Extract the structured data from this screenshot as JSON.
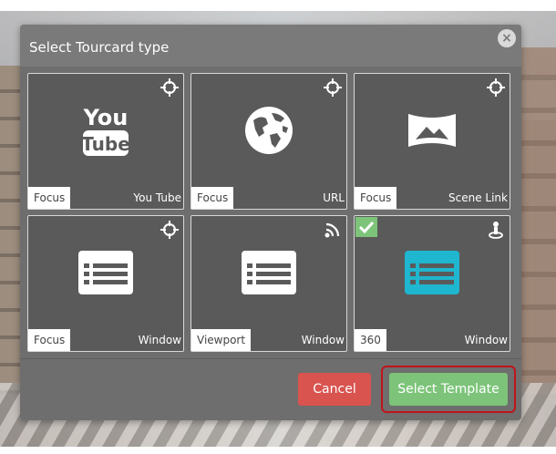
{
  "modal": {
    "title": "Select Tourcard type",
    "close_label": "×"
  },
  "cards": [
    {
      "tag": "Focus",
      "type": "You Tube",
      "icon": "youtube-icon",
      "corner_icon": "crosshair-icon",
      "checked": false
    },
    {
      "tag": "Focus",
      "type": "URL",
      "icon": "globe-icon",
      "corner_icon": "crosshair-icon",
      "checked": false
    },
    {
      "tag": "Focus",
      "type": "Scene Link",
      "icon": "panorama-icon",
      "corner_icon": "crosshair-icon",
      "checked": false
    },
    {
      "tag": "Focus",
      "type": "Window",
      "icon": "window-list-icon",
      "corner_icon": "crosshair-icon",
      "checked": false
    },
    {
      "tag": "Viewport",
      "type": "Window",
      "icon": "window-list-icon",
      "corner_icon": "signal-icon",
      "checked": false
    },
    {
      "tag": "360",
      "type": "Window",
      "icon": "window-list-icon",
      "corner_icon": "person-pin-icon",
      "checked": true
    }
  ],
  "buttons": {
    "cancel": "Cancel",
    "select": "Select Template"
  },
  "colors": {
    "card_bg": "#5a5a5a",
    "selected_icon": "#1fb6cf",
    "cancel": "#d9534f",
    "select": "#7dc47a",
    "highlight": "#c0141b"
  }
}
